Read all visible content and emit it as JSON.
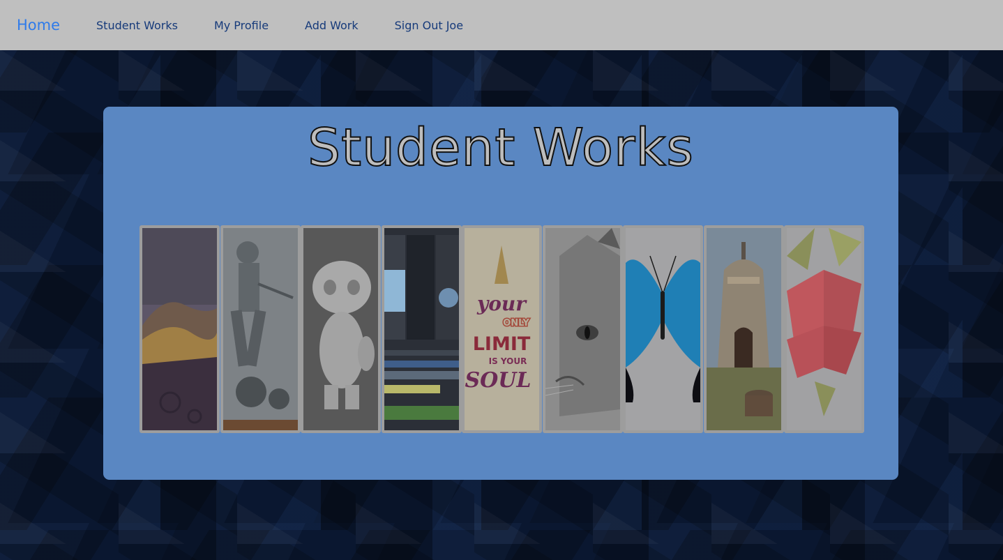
{
  "nav": {
    "home": "Home",
    "student_works": "Student Works",
    "my_profile": "My Profile",
    "add_work": "Add Work",
    "sign_out": "Sign Out Joe"
  },
  "panel": {
    "title": "Student Works"
  },
  "gallery": {
    "poster_text": {
      "line1": "your",
      "line2": "ONLY",
      "line3": "LIMIT",
      "line4": "IS YOUR",
      "line5": "SOUL"
    }
  },
  "colors": {
    "navbar_bg": "#bfbfbf",
    "nav_link": "#163a7a",
    "nav_home": "#2f7bea",
    "panel_bg": "#5a87c2"
  }
}
